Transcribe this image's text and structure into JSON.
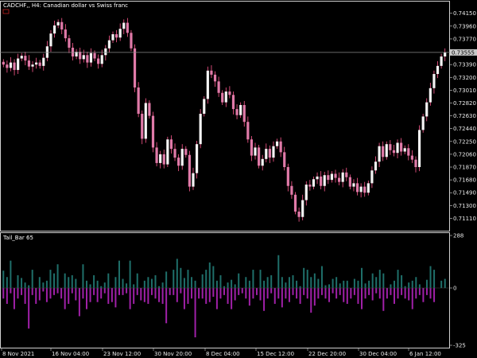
{
  "window": {
    "symbol_title": "CADCHF,, H4:  Canadian dollar vs Swiss franc",
    "indicator_title": "Tail_Bar 65",
    "current_price_label": "0.73555"
  },
  "colors": {
    "background": "#000000",
    "grid_border": "#d0d0d0",
    "candle_bull": "#f4f4f4",
    "candle_bear": "#e07aa8",
    "wick": "#ff5a90",
    "histogram_positive": "#1f6f6a",
    "histogram_negative": "#a020a8",
    "current_price_line": "#8a8a8a",
    "current_price_box": "#c8c8c8"
  },
  "main_chart": {
    "y_min": 0.7095,
    "y_max": 0.743,
    "price_ticks": [
      "0.74150",
      "0.73960",
      "0.73770",
      "0.73580",
      "0.73390",
      "0.73200",
      "0.73010",
      "0.72820",
      "0.72630",
      "0.72440",
      "0.72250",
      "0.72060",
      "0.71870",
      "0.71680",
      "0.71490",
      "0.71300",
      "0.71110"
    ],
    "current_price": 0.7357,
    "close_series": [
      0.7339,
      0.7334,
      0.7342,
      0.7331,
      0.7348,
      0.7352,
      0.7345,
      0.7336,
      0.7339,
      0.7342,
      0.7337,
      0.7349,
      0.7366,
      0.7385,
      0.7397,
      0.7402,
      0.7391,
      0.7378,
      0.7364,
      0.7351,
      0.7358,
      0.7347,
      0.7353,
      0.7342,
      0.7356,
      0.7348,
      0.734,
      0.7353,
      0.7363,
      0.7375,
      0.7384,
      0.7379,
      0.7392,
      0.7401,
      0.7386,
      0.7363,
      0.7305,
      0.7266,
      0.7229,
      0.7282,
      0.7263,
      0.7216,
      0.7193,
      0.7206,
      0.7191,
      0.7228,
      0.7214,
      0.7201,
      0.7189,
      0.7214,
      0.7205,
      0.7158,
      0.7178,
      0.7221,
      0.7266,
      0.7288,
      0.733,
      0.7324,
      0.7314,
      0.7297,
      0.7283,
      0.7299,
      0.7294,
      0.7273,
      0.7264,
      0.7279,
      0.7254,
      0.7228,
      0.7204,
      0.7216,
      0.7189,
      0.7199,
      0.7214,
      0.7201,
      0.7218,
      0.7225,
      0.7209,
      0.7187,
      0.7159,
      0.7146,
      0.7121,
      0.7113,
      0.7138,
      0.7161,
      0.7158,
      0.7169,
      0.7173,
      0.7159,
      0.7175,
      0.7168,
      0.7177,
      0.7171,
      0.7165,
      0.7179,
      0.7172,
      0.7158,
      0.7163,
      0.715,
      0.7158,
      0.7149,
      0.7163,
      0.7182,
      0.7195,
      0.7218,
      0.7202,
      0.7221,
      0.7212,
      0.7208,
      0.7223,
      0.721,
      0.7215,
      0.7204,
      0.7198,
      0.7187,
      0.7242,
      0.7262,
      0.7283,
      0.7304,
      0.7325,
      0.7337,
      0.7351,
      0.7357
    ],
    "time_labels": [
      "8 Nov 2021",
      "16 Nov 04:00",
      "23 Nov 12:00",
      "30 Nov 20:00",
      "8 Dec 04:00",
      "15 Dec 12:00",
      "22 Dec 20:00",
      "30 Dec 04:00",
      "6 Jan 12:00"
    ]
  },
  "indicator": {
    "y_min": -325,
    "y_max": 288,
    "ticks": [
      "288",
      "0",
      "-325"
    ],
    "positive_values": [
      95,
      60,
      150,
      0,
      70,
      55,
      30,
      15,
      100,
      0,
      60,
      30,
      40,
      100,
      80,
      130,
      0,
      80,
      60,
      70,
      50,
      0,
      130,
      40,
      20,
      70,
      40,
      10,
      30,
      80,
      0,
      60,
      150,
      50,
      25,
      150,
      20,
      80,
      0,
      40,
      60,
      50,
      70,
      10,
      30,
      90,
      0,
      100,
      160,
      110,
      55,
      100,
      60,
      40,
      0,
      75,
      100,
      140,
      120,
      40,
      70,
      10,
      30,
      45,
      20,
      80,
      0,
      60,
      40,
      100,
      0,
      100,
      40,
      60,
      70,
      0,
      180,
      60,
      30,
      60,
      70,
      40,
      10,
      110,
      100,
      60,
      80,
      50,
      120,
      15,
      20,
      50,
      60,
      25,
      40,
      40,
      0,
      50,
      40,
      110,
      25,
      40,
      80,
      60,
      100,
      80,
      0,
      20,
      40,
      100,
      70,
      10,
      30,
      40,
      60,
      20,
      0,
      45,
      120,
      100,
      0,
      40,
      50
    ],
    "negative_values": [
      -60,
      -90,
      -30,
      -120,
      -60,
      -40,
      -90,
      -230,
      -40,
      -90,
      -70,
      -20,
      -80,
      -60,
      -40,
      -30,
      -60,
      -120,
      -90,
      -30,
      -70,
      -160,
      -60,
      -120,
      -80,
      -40,
      -80,
      -60,
      -30,
      -90,
      -80,
      -110,
      -40,
      -40,
      -30,
      -120,
      -90,
      -40,
      -70,
      -80,
      -90,
      -40,
      -60,
      -80,
      -90,
      -200,
      -40,
      -40,
      -80,
      -30,
      -120,
      -90,
      -60,
      -280,
      -60,
      -60,
      -90,
      -80,
      -50,
      -120,
      -60,
      -40,
      -90,
      -120,
      -70,
      -40,
      -30,
      -60,
      -100,
      -60,
      -40,
      -70,
      -130,
      -60,
      -30,
      -90,
      -60,
      -110,
      -60,
      -80,
      -40,
      -60,
      -90,
      -40,
      -60,
      -140,
      -100,
      -60,
      -40,
      -60,
      -80,
      -30,
      -60,
      -40,
      -80,
      -90,
      -60,
      -40,
      -90,
      -120,
      -60,
      -40,
      -70,
      -30,
      -60,
      -130,
      -60,
      -40,
      -90,
      -60,
      -40,
      -60,
      -70,
      -120,
      -60,
      -40,
      -80,
      -40,
      -60,
      -80
    ]
  }
}
